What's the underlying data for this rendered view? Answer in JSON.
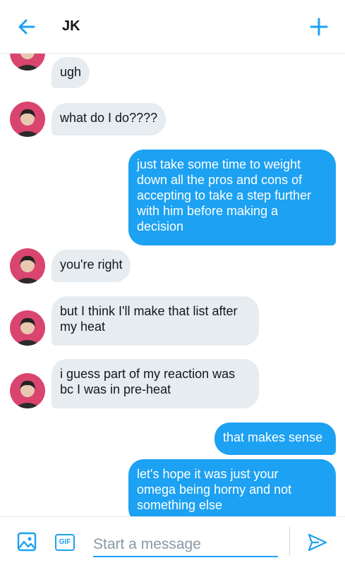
{
  "header": {
    "title": "JK",
    "back_icon": "arrow-left-icon",
    "new_icon": "plus-icon"
  },
  "colors": {
    "accent": "#1da1f2",
    "incoming_bubble": "#e6ecf0",
    "avatar_bg": "#d9456e"
  },
  "messages": [
    {
      "from": "them",
      "text": "ugh"
    },
    {
      "from": "them",
      "text": "what do I do????"
    },
    {
      "from": "me",
      "text": "just take some time to weight\ndown all the pros and cons of\naccepting to take a step further\nwith him before making a\ndecision"
    },
    {
      "from": "them",
      "text": "you're right"
    },
    {
      "from": "them",
      "text": "but I think I'll make that list after\nmy heat"
    },
    {
      "from": "them",
      "text": "i guess part of my reaction was\nbc I was in pre-heat"
    },
    {
      "from": "me",
      "text": "that makes sense"
    },
    {
      "from": "me",
      "text": "let's hope it was just your\nomega being horny and not\nsomething else"
    }
  ],
  "composer": {
    "placeholder": "Start a message",
    "gif_label": "GIF"
  }
}
